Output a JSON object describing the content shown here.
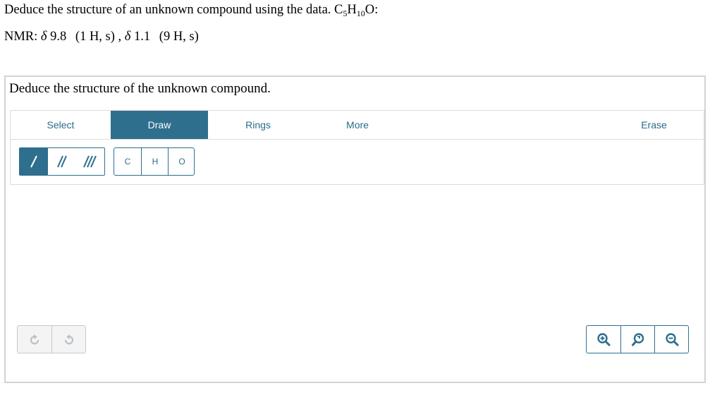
{
  "question": {
    "line1_prefix": "Deduce the structure of an unknown compound using the data.",
    "formula": {
      "c": "C",
      "c_sub": "5",
      "h": "H",
      "h_sub": "10",
      "o": "O",
      "suffix": ":"
    },
    "nmr": {
      "label": "NMR:",
      "peak1": {
        "delta": "δ",
        "shift": "9.8",
        "detail": "(1 H, s)"
      },
      "separator": ",",
      "peak2": {
        "delta": "δ",
        "shift": "1.1",
        "detail": "(9 H, s)"
      }
    }
  },
  "panel": {
    "title": "Deduce the structure of the unknown compound."
  },
  "toolbar": {
    "tabs": [
      {
        "label": "Select",
        "active": false
      },
      {
        "label": "Draw",
        "active": true
      },
      {
        "label": "Rings",
        "active": false
      },
      {
        "label": "More",
        "active": false
      },
      {
        "label": "Erase",
        "active": false
      }
    ]
  },
  "tools": {
    "bonds": [
      {
        "icon": "single-bond-icon",
        "active": true
      },
      {
        "icon": "double-bond-icon",
        "active": false
      },
      {
        "icon": "triple-bond-icon",
        "active": false
      }
    ],
    "atoms": [
      "C",
      "H",
      "O"
    ]
  },
  "history": {
    "buttons": [
      {
        "icon": "undo-icon"
      },
      {
        "icon": "redo-icon"
      }
    ]
  },
  "zoom": {
    "buttons": [
      {
        "icon": "zoom-in-icon"
      },
      {
        "icon": "reset-zoom-icon"
      },
      {
        "icon": "zoom-out-icon"
      }
    ]
  },
  "colors": {
    "accent": "#2e6f8e",
    "tab_text": "#2a6c8c",
    "border": "#d3d3d3",
    "disabled": "#b9c2c8"
  }
}
